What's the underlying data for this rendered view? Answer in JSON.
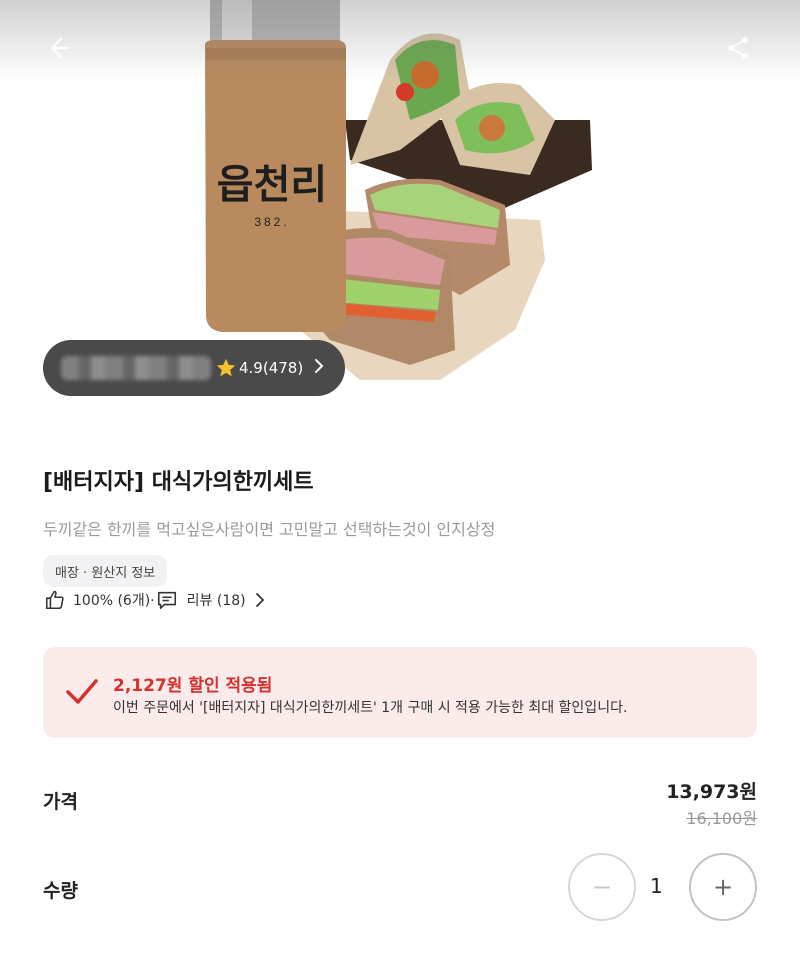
{
  "header": {
    "back_icon": "back-arrow-icon",
    "share_icon": "share-icon"
  },
  "store": {
    "rating": "4.9(478)",
    "star_icon": "star-icon",
    "chevron_icon": "chevron-right-icon",
    "cup_text": "읍천리",
    "cup_subtext": "382."
  },
  "product": {
    "title": "[배터지자] 대식가의한끼세트",
    "description": "두끼같은 한끼를 먹고싶은사람이면 고민말고 선택하는것이 인지상정",
    "info_chip": "매장 · 원산지 정보",
    "like_text": "100% (6개)·",
    "review_text": "리뷰 (18)"
  },
  "discount": {
    "title": "2,127원 할인 적용됨",
    "subtitle": "이번 주문에서 '[배터지자] 대식가의한끼세트' 1개 구매 시 적용 가능한 최대 할인입니다.",
    "accent_color": "#d4312d",
    "background_color": "#fbeceb"
  },
  "price": {
    "label": "가격",
    "current": "13,973원",
    "original": "16,100원"
  },
  "quantity": {
    "label": "수량",
    "minus": "−",
    "value": "1",
    "plus": "+"
  }
}
